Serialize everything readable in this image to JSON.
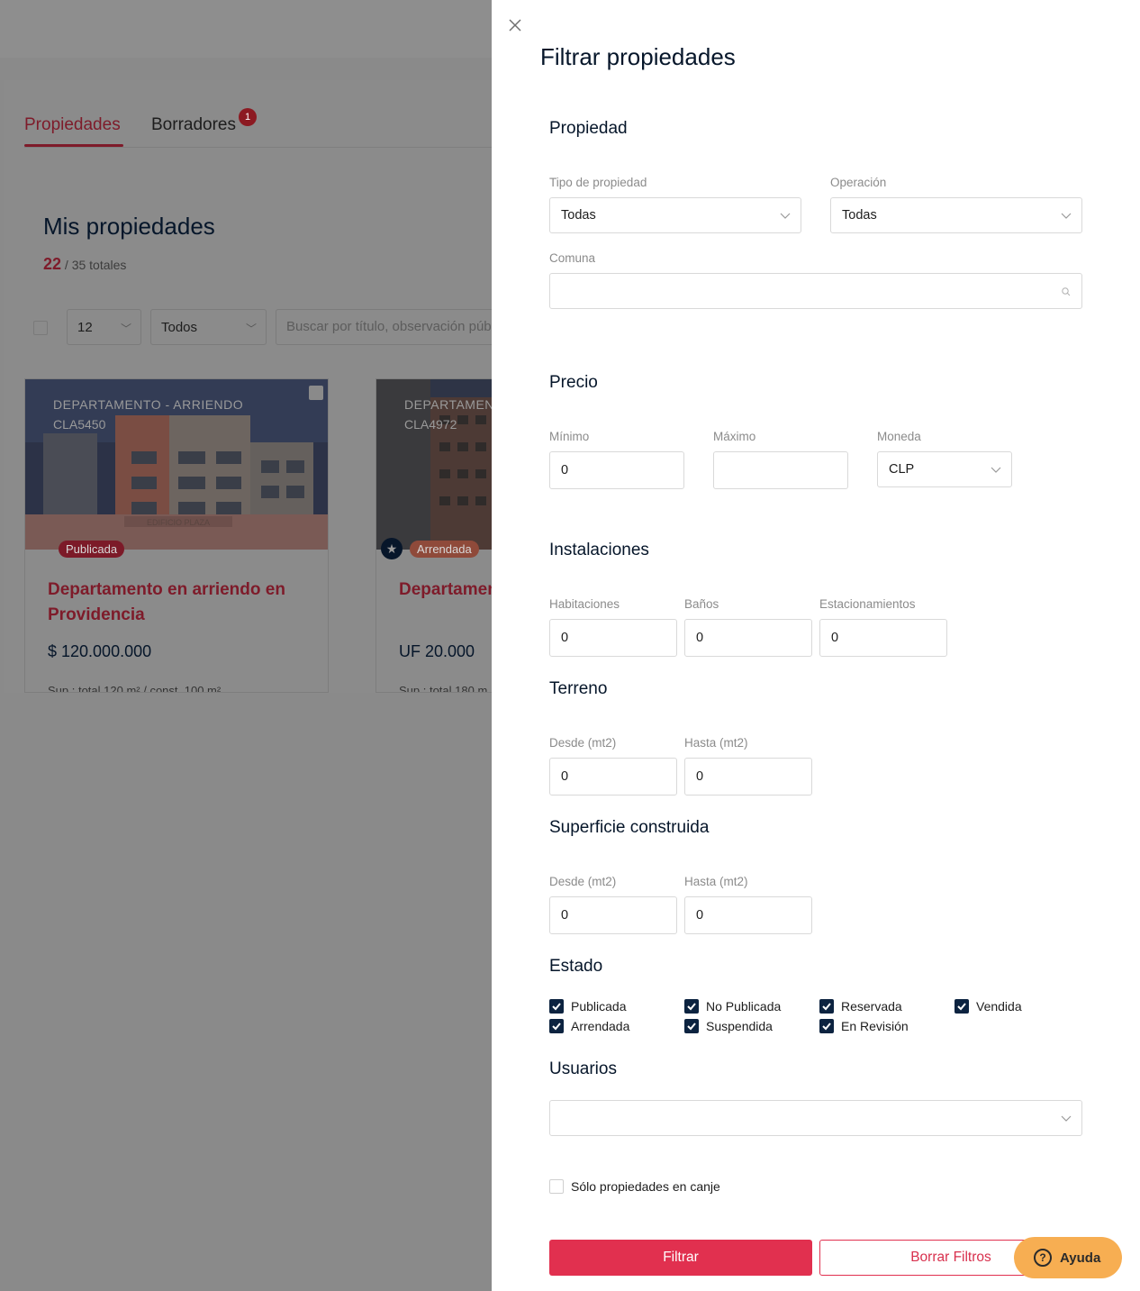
{
  "background": {
    "tabs": [
      {
        "label": "Propiedades"
      },
      {
        "label": "Borradores",
        "badge": "1"
      }
    ],
    "title": "Mis propiedades",
    "count": {
      "active": "22",
      "total_text": "/ 35 totales"
    },
    "per_page": "12",
    "status_select": "Todos",
    "search_placeholder": "Buscar por título, observación púb",
    "cards": [
      {
        "type_label": "DEPARTAMENTO - ARRIENDO",
        "code": "CLA5450",
        "status": "Publicada",
        "name": "Departamento en arriendo en Providencia",
        "price": "$ 120.000.000",
        "surface": "Sup.: total 120 m² / const. 100 m²",
        "building_sign": "EDIFICIO PLAZA"
      },
      {
        "type_label": "DEPARTAMENT",
        "code": "CLA4972",
        "status": "Arrendada",
        "name": "Departamen Providencia",
        "price": "UF 20.000",
        "surface": "Sup.: total 180 m"
      }
    ]
  },
  "drawer": {
    "title": "Filtrar propiedades",
    "sections": {
      "propiedad": "Propiedad",
      "precio": "Precio",
      "instalaciones": "Instalaciones",
      "terreno": "Terreno",
      "superficie": "Superficie construida",
      "estado": "Estado",
      "usuarios": "Usuarios"
    },
    "tipo_propiedad": {
      "label": "Tipo de propiedad",
      "value": "Todas"
    },
    "operacion": {
      "label": "Operación",
      "value": "Todas"
    },
    "comuna": {
      "label": "Comuna",
      "value": ""
    },
    "precio": {
      "minimo": {
        "label": "Mínimo",
        "value": "0"
      },
      "maximo": {
        "label": "Máximo",
        "value": ""
      },
      "moneda": {
        "label": "Moneda",
        "value": "CLP"
      }
    },
    "instalaciones": {
      "habitaciones": {
        "label": "Habitaciones",
        "value": "0"
      },
      "banos": {
        "label": "Baños",
        "value": "0"
      },
      "estacionamientos": {
        "label": "Estacionamientos",
        "value": "0"
      }
    },
    "terreno": {
      "desde": {
        "label": "Desde (mt2)",
        "value": "0"
      },
      "hasta": {
        "label": "Hasta (mt2)",
        "value": "0"
      }
    },
    "superficie": {
      "desde": {
        "label": "Desde (mt2)",
        "value": "0"
      },
      "hasta": {
        "label": "Hasta (mt2)",
        "value": "0"
      }
    },
    "estado_options": [
      {
        "label": "Publicada",
        "checked": true
      },
      {
        "label": "No Publicada",
        "checked": true
      },
      {
        "label": "Reservada",
        "checked": true
      },
      {
        "label": "Vendida",
        "checked": true
      },
      {
        "label": "Arrendada",
        "checked": true
      },
      {
        "label": "Suspendida",
        "checked": true
      },
      {
        "label": "En Revisión",
        "checked": true
      }
    ],
    "usuarios_value": "",
    "canje": {
      "label": "Sólo propiedades en canje",
      "checked": false
    },
    "buttons": {
      "filtrar": "Filtrar",
      "borrar": "Borrar Filtros"
    }
  },
  "help": {
    "label": "Ayuda"
  },
  "colors": {
    "primary": "#e1304f",
    "navy": "#0c2340",
    "help": "#f7ae52",
    "overlay": "#8a8a8a"
  }
}
